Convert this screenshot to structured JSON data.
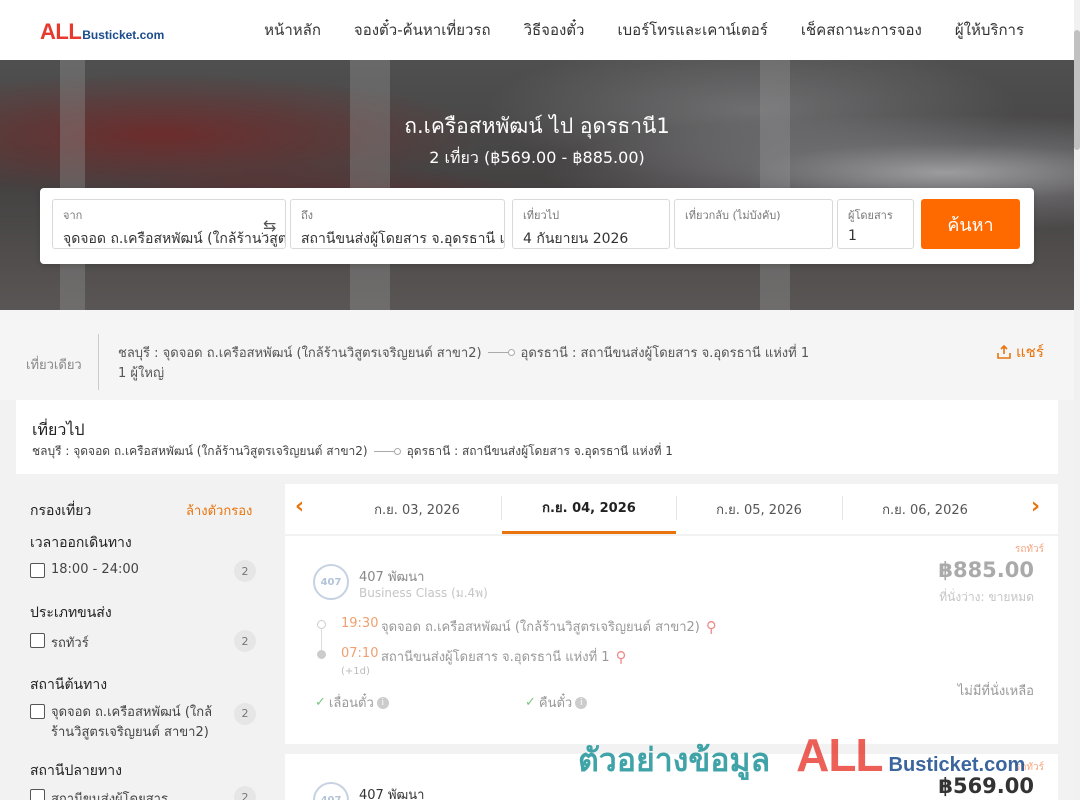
{
  "logo": {
    "brand_a": "ALL",
    "brand_b": "Busticket.com"
  },
  "nav": [
    "หน้าหลัก",
    "จองตั๋ว-ค้นหาเที่ยวรถ",
    "วิธีจองตั๋ว",
    "เบอร์โทรและเคาน์เตอร์",
    "เช็คสถานะการจอง",
    "ผู้ให้บริการ"
  ],
  "hero": {
    "title": "ถ.เครือสหพัฒน์ ไป อุดรธานี1",
    "subtitle": "2 เที่ยว (฿569.00 - ฿885.00)"
  },
  "search": {
    "from_label": "จาก",
    "from_value": "จุดจอด ถ.เครือสหพัฒน์ (ใกล้ร้านวิสูตรเจริญยนต์ สาขา2)",
    "to_label": "ถึง",
    "to_value": "สถานีขนส่งผู้โดยสาร จ.อุดรธานี แห่งที่ 1",
    "depart_label": "เที่ยวไป",
    "depart_value": "4 กันยายน 2026",
    "return_label": "เที่ยวกลับ (ไม่บังคับ)",
    "return_value": "",
    "pax_label": "ผู้โดยสาร",
    "pax_value": "1",
    "button": "ค้นหา"
  },
  "summary": {
    "trip_type": "เที่ยวเดียว",
    "origin": "ชลบุรี : จุดจอด ถ.เครือสหพัฒน์ (ใกล้ร้านวิสูตรเจริญยนต์ สาขา2)",
    "destination": "อุดรธานี : สถานีขนส่งผู้โดยสาร จ.อุดรธานี แห่งที่ 1",
    "passengers": "1 ผู้ใหญ่",
    "share": "แชร์"
  },
  "outbound": {
    "title": "เที่ยวไป",
    "origin": "ชลบุรี : จุดจอด ถ.เครือสหพัฒน์ (ใกล้ร้านวิสูตรเจริญยนต์ สาขา2)",
    "destination": "อุดรธานี : สถานีขนส่งผู้โดยสาร จ.อุดรธานี แห่งที่ 1"
  },
  "filters": {
    "title": "กรองเที่ยว",
    "clear": "ล้างตัวกรอง",
    "sections": [
      {
        "title": "เวลาออกเดินทาง",
        "options": [
          {
            "label": "18:00 - 24:00",
            "count": "2"
          }
        ]
      },
      {
        "title": "ประเภทขนส่ง",
        "options": [
          {
            "label": "รถทัวร์",
            "count": "2"
          }
        ]
      },
      {
        "title": "สถานีต้นทาง",
        "options": [
          {
            "label": "จุดจอด ถ.เครือสหพัฒน์ (ใกล้ร้านวิสูตรเจริญยนต์ สาขา2)",
            "count": "2"
          }
        ]
      },
      {
        "title": "สถานีปลายทาง",
        "options": [
          {
            "label": "สถานีขนส่งผู้โดยสาร",
            "count": "2"
          }
        ]
      }
    ]
  },
  "dates": [
    "ก.ย. 03, 2026",
    "ก.ย. 04, 2026",
    "ก.ย. 05, 2026",
    "ก.ย. 06, 2026"
  ],
  "trips": [
    {
      "badge": "รถทัวร์",
      "logo_text": "407",
      "operator": "407 พัฒนา",
      "class": "Business Class (ม.4พ)",
      "price": "฿885.00",
      "seats": "ที่นั่งว่าง: ขายหมด",
      "dep_time": "19:30",
      "dep_station": "จุดจอด ถ.เครือสหพัฒน์ (ใกล้ร้านวิสูตรเจริญยนต์ สาขา2)",
      "arr_time": "07:10",
      "arr_station": "สถานีขนส่งผู้โดยสาร จ.อุดรธานี แห่งที่ 1",
      "next_day": "(+1d)",
      "feature_1": "เลื่อนตั๋ว",
      "feature_2": "คืนตั๋ว",
      "availability": "ไม่มีที่นั่งเหลือ"
    },
    {
      "badge": "รถทัวร์",
      "logo_text": "407",
      "operator": "407 พัฒนา",
      "price": "฿569.00"
    }
  ],
  "watermark": {
    "text": "ตัวอย่างข้อมูล",
    "brand_a": "ALL",
    "brand_b": "Busticket.com"
  },
  "colors": {
    "accent": "#ff6a00",
    "brand_red": "#e8392e",
    "brand_blue": "#1a4b8c"
  }
}
